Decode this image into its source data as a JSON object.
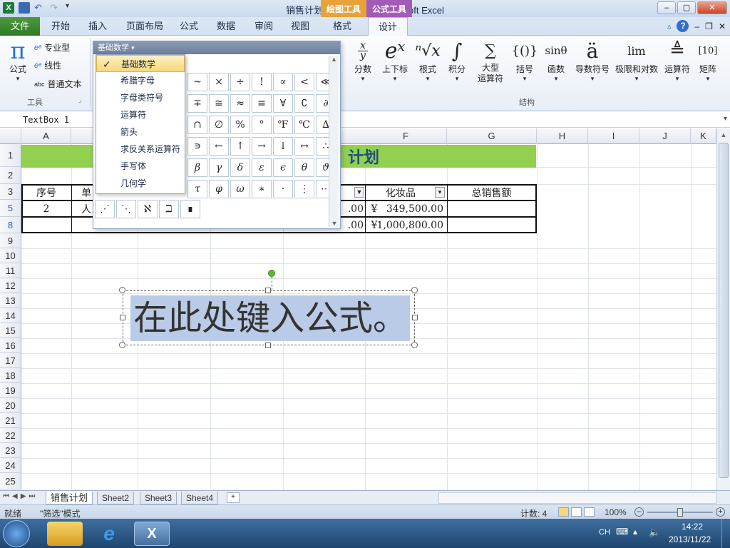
{
  "window": {
    "title": "销售计划1 [兼容模式] - Microsoft Excel",
    "context_tab_drawing": "绘图工具",
    "context_tab_formula": "公式工具",
    "btn_min": "–",
    "btn_max": "▢",
    "btn_close": "✕"
  },
  "tabs": {
    "file": "文件",
    "items": [
      "开始",
      "插入",
      "页面布局",
      "公式",
      "数据",
      "审阅",
      "视图"
    ],
    "format": "格式",
    "design": "设计"
  },
  "ribbon": {
    "tools": {
      "formula": "公式",
      "professional": "专业型",
      "linear": "线性",
      "plaintext": "普通文本",
      "group": "工具"
    },
    "structure": {
      "group": "结构",
      "items": [
        {
          "label": "分数",
          "sym": "x/y"
        },
        {
          "label": "上下标",
          "sym": "eˣ"
        },
        {
          "label": "根式",
          "sym": "ⁿ√x"
        },
        {
          "label": "积分",
          "sym": "∫"
        },
        {
          "label": "大型\n运算符",
          "sym": "∑"
        },
        {
          "label": "括号",
          "sym": "{()}"
        },
        {
          "label": "函数",
          "sym": "sinθ"
        },
        {
          "label": "导数符号",
          "sym": "ä"
        },
        {
          "label": "极限和对数",
          "sym": "lim"
        },
        {
          "label": "运算符",
          "sym": "≜"
        },
        {
          "label": "矩阵",
          "sym": "[10]"
        }
      ]
    }
  },
  "formula_bar": {
    "name_box": "TextBox 1"
  },
  "gallery": {
    "header": "基础数学",
    "symbols_row1": [
      "~",
      "×",
      "÷",
      "!",
      "∝",
      "<",
      "≪"
    ],
    "symbols_row2": [
      "∓",
      "≅",
      "≈",
      "≡",
      "∀",
      "∁",
      "∂"
    ],
    "symbols_row3": [
      "∩",
      "∅",
      "%",
      "°",
      "℉",
      "℃",
      "∆"
    ],
    "symbols_row4": [
      "∍",
      "←",
      "↑",
      "→",
      "↓",
      "↔",
      "∴"
    ],
    "symbols_row5": [
      "β",
      "γ",
      "δ",
      "ε",
      "ϵ",
      "θ",
      "ϑ"
    ],
    "symbols_row6": [
      "τ",
      "φ",
      "ω",
      "∗",
      "·",
      "⋮",
      "⋯"
    ],
    "symbols_row7": [
      "⋰",
      "⋱",
      "ℵ",
      "ℶ",
      "∎"
    ]
  },
  "menu": {
    "items": [
      "基础数学",
      "希腊字母",
      "字母类符号",
      "运算符",
      "箭头",
      "求反关系运算符",
      "手写体",
      "几何学"
    ],
    "check": "✓"
  },
  "sheet": {
    "columns": [
      "A",
      "F",
      "G",
      "H",
      "I",
      "J",
      "K"
    ],
    "rows": [
      "1",
      "2",
      "3",
      "5",
      "8",
      "9",
      "10",
      "11",
      "12",
      "13",
      "14",
      "15",
      "16",
      "17",
      "18",
      "19",
      "20",
      "21",
      "22",
      "23",
      "24",
      "25"
    ],
    "title_text": "计划",
    "header_seq": "序号",
    "header_b": "单",
    "header_cosmetics": "化妆品",
    "header_total": "总销售额",
    "r5_a": "2",
    "r5_b": "人",
    "r5_e": ".00",
    "r5_f_cur": "¥",
    "r5_f": "349,500.00",
    "r8_e": ".00",
    "r8_f_cur": "¥",
    "r8_f": "1,000,800.00"
  },
  "textbox": {
    "text": "在此处键入公式。"
  },
  "sheet_tabs": [
    "销售计划",
    "Sheet2",
    "Sheet3",
    "Sheet4"
  ],
  "status": {
    "ready": "就绪",
    "filter_mode": "\"筛选\"模式",
    "count": "计数: 4",
    "zoom": "100%"
  },
  "taskbar": {
    "lang": "CH",
    "time": "14:22",
    "date": "2013/11/22"
  },
  "colors": {
    "title_green": "#92d050",
    "file_green": "#2f7a23",
    "drawing_tab": "#e8a23a",
    "formula_tab": "#a35bb9"
  }
}
